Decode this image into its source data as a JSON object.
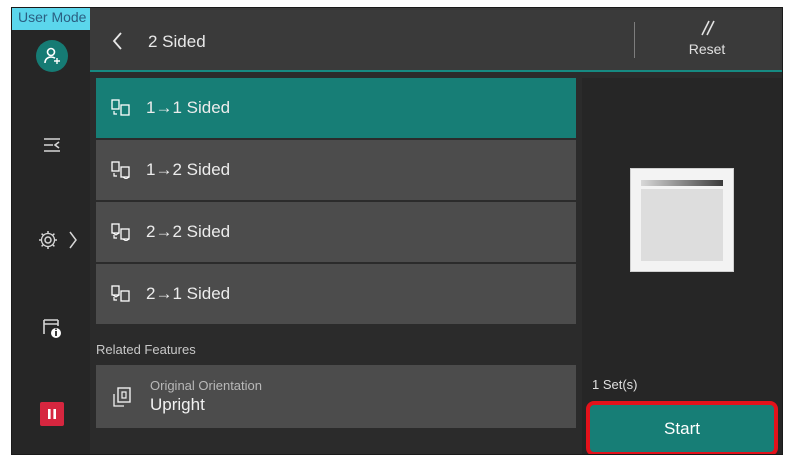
{
  "mode_tab": {
    "label": "User Mode"
  },
  "header": {
    "title": "2 Sided",
    "reset_label": "Reset",
    "back_icon": "chevron-left-icon"
  },
  "sidebar": {
    "items": [
      {
        "name": "user",
        "icon": "user-icon"
      },
      {
        "name": "job-list",
        "icon": "job-list-icon"
      },
      {
        "name": "settings",
        "icon": "gear-icon"
      },
      {
        "name": "machine-status",
        "icon": "printer-info-icon"
      },
      {
        "name": "pause",
        "icon": "pause-icon"
      }
    ]
  },
  "options": [
    {
      "label": "1→1 Sided",
      "selected": true
    },
    {
      "label": "1→2 Sided",
      "selected": false
    },
    {
      "label": "2→2 Sided",
      "selected": false
    },
    {
      "label": "2→1 Sided",
      "selected": false
    }
  ],
  "related": {
    "heading": "Related Features",
    "item": {
      "title": "Original Orientation",
      "value": "Upright"
    }
  },
  "quantity": {
    "label": "1 Set(s)"
  },
  "start": {
    "label": "Start"
  },
  "colors": {
    "accent": "#177e76",
    "highlight_border": "#e3121b",
    "mode_tab": "#5bd6ec",
    "pause": "#d6263f"
  }
}
